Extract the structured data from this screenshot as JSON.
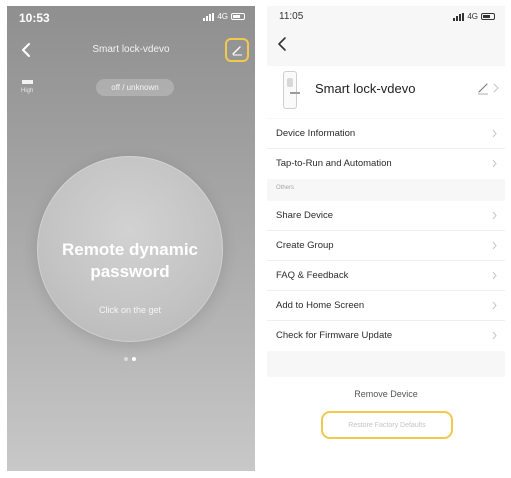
{
  "left_screen": {
    "status_time": "10:53",
    "network": "4G",
    "nav_title": "Smart lock-vdevo",
    "battery_label": "High",
    "status_pill": "off / unknown",
    "circle_title_line1": "Remote dynamic",
    "circle_title_line2": "password",
    "circle_subtitle": "Click on the get",
    "page_dots": {
      "count": 2,
      "active_index": 1
    }
  },
  "right_screen": {
    "status_time": "11:05",
    "network": "4G",
    "device_name": "Smart lock-vdevo",
    "group1": [
      {
        "label": "Device Information"
      },
      {
        "label": "Tap-to-Run and Automation"
      }
    ],
    "section_label": "Others",
    "group2": [
      {
        "label": "Share Device"
      },
      {
        "label": "Create Group"
      },
      {
        "label": "FAQ & Feedback"
      },
      {
        "label": "Add to Home Screen"
      },
      {
        "label": "Check for Firmware Update"
      }
    ],
    "remove_device": "Remove Device",
    "restore_defaults": "Restore Factory Defaults"
  },
  "colors": {
    "highlight_outline": "#f2c94c",
    "left_background": "#a5a5a5",
    "right_background": "#f7f7f7"
  },
  "icons": [
    "back-arrow-icon",
    "edit-pencil-icon",
    "battery-icon",
    "signal-icon",
    "lock-device-icon",
    "chevron-right-icon"
  ]
}
